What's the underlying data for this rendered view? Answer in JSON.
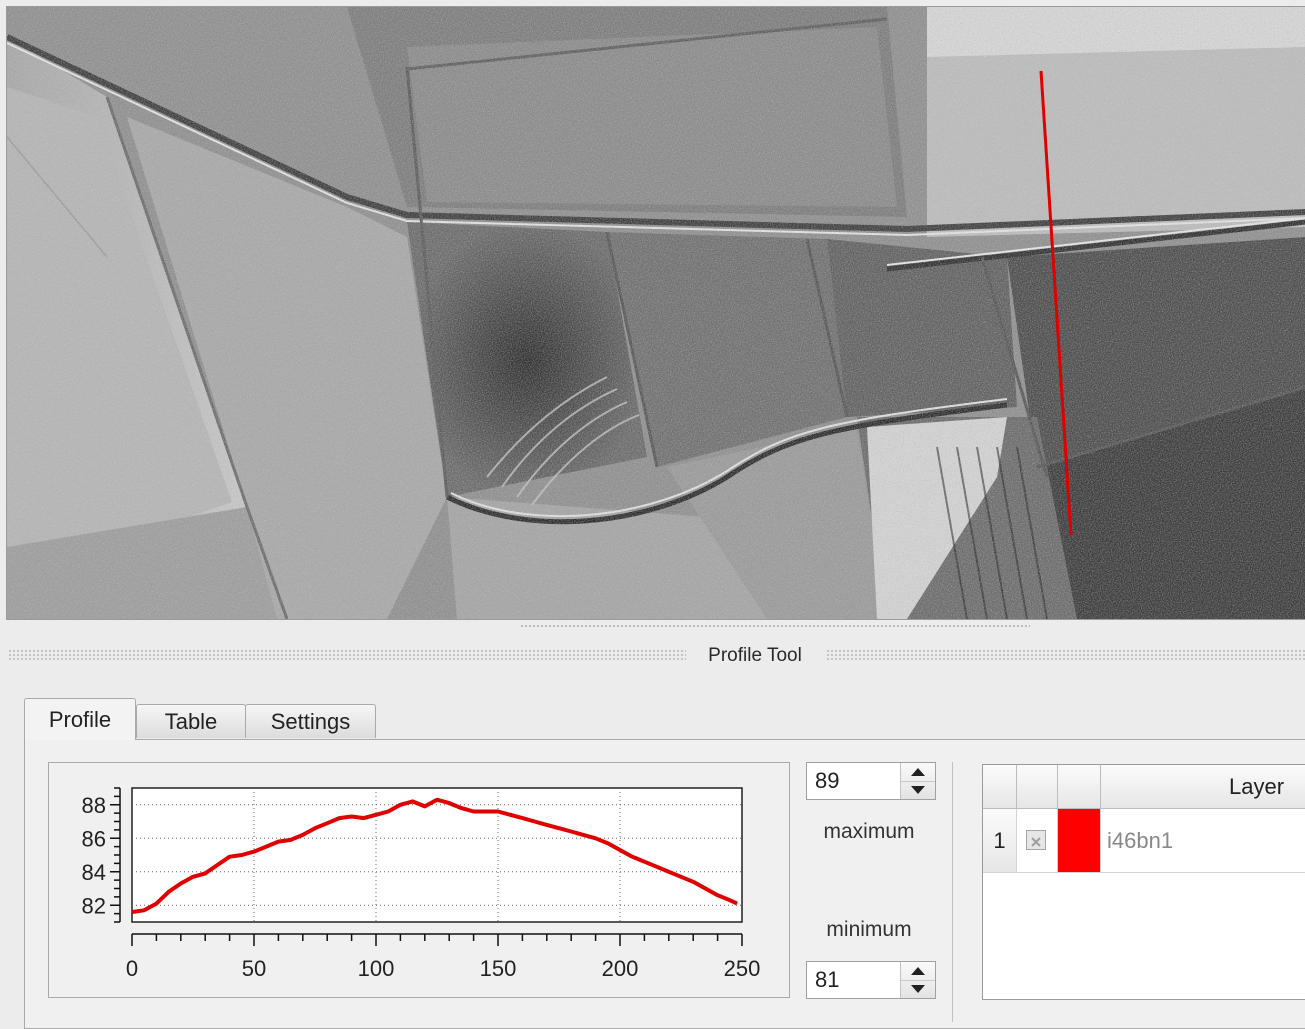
{
  "dock": {
    "title": "Profile Tool"
  },
  "tabs": [
    {
      "label": "Profile",
      "active": true
    },
    {
      "label": "Table",
      "active": false
    },
    {
      "label": "Settings",
      "active": false
    }
  ],
  "scale": {
    "max_value": "89",
    "max_label": "maximum",
    "min_value": "81",
    "min_label": "minimum"
  },
  "layers": {
    "header": {
      "col_layer": "Layer"
    },
    "rows": [
      {
        "index": "1",
        "visible": false,
        "color": "#ff0000",
        "name": "i46bn1"
      }
    ]
  },
  "chart_data": {
    "type": "line",
    "xlim": [
      0,
      250
    ],
    "ylim": [
      81,
      89
    ],
    "x_ticks": [
      0,
      50,
      100,
      150,
      200,
      250
    ],
    "y_ticks": [
      82,
      84,
      86,
      88
    ],
    "grid": true,
    "series": [
      {
        "color": "#e00000",
        "x": [
          0,
          5,
          10,
          15,
          20,
          25,
          30,
          35,
          40,
          45,
          50,
          55,
          60,
          65,
          70,
          75,
          80,
          85,
          90,
          95,
          100,
          105,
          110,
          115,
          120,
          125,
          130,
          135,
          140,
          145,
          150,
          155,
          160,
          165,
          170,
          175,
          180,
          185,
          190,
          195,
          200,
          205,
          210,
          215,
          220,
          225,
          230,
          235,
          240,
          245,
          248
        ],
        "y": [
          81.6,
          81.7,
          82.1,
          82.8,
          83.3,
          83.7,
          83.9,
          84.4,
          84.9,
          85.0,
          85.2,
          85.5,
          85.8,
          85.9,
          86.2,
          86.6,
          86.9,
          87.2,
          87.3,
          87.2,
          87.4,
          87.6,
          88.0,
          88.2,
          87.9,
          88.3,
          88.1,
          87.8,
          87.6,
          87.6,
          87.6,
          87.4,
          87.2,
          87.0,
          86.8,
          86.6,
          86.4,
          86.2,
          86.0,
          85.7,
          85.3,
          84.9,
          84.6,
          84.3,
          84.0,
          83.7,
          83.4,
          83.0,
          82.6,
          82.3,
          82.1
        ]
      }
    ]
  }
}
